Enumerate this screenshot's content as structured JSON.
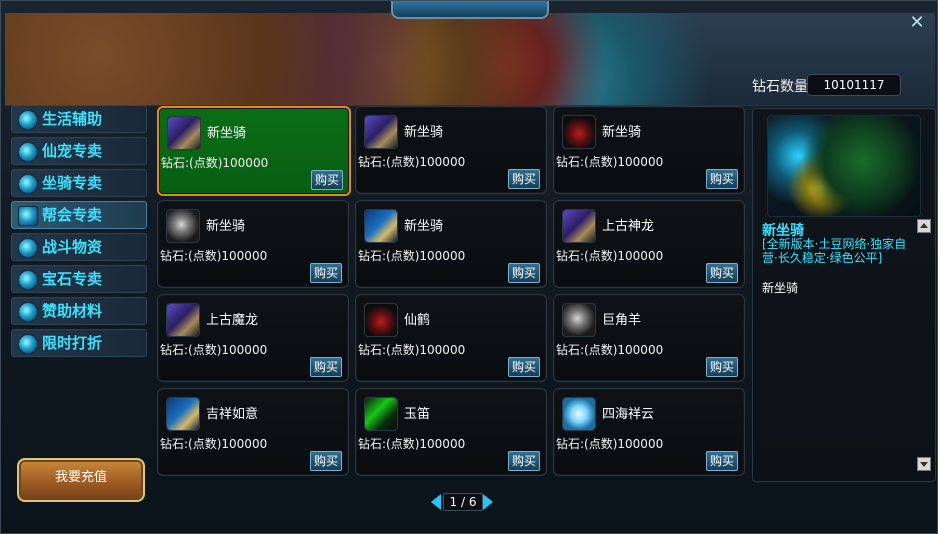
{
  "header": {
    "diamond_label": "钻石数量",
    "diamond_value": "10101117",
    "close_icon": "close-icon"
  },
  "menu": [
    {
      "label": "生活辅助",
      "icon": "life-icon"
    },
    {
      "label": "仙宠专卖",
      "icon": "paw-icon"
    },
    {
      "label": "坐骑专卖",
      "icon": "mount-icon"
    },
    {
      "label": "帮会专卖",
      "icon": "guild-icon"
    },
    {
      "label": "战斗物资",
      "icon": "battle-icon"
    },
    {
      "label": "宝石专卖",
      "icon": "gem-icon"
    },
    {
      "label": "赞助材料",
      "icon": "sponsor-icon"
    },
    {
      "label": "限时打折",
      "icon": "megaphone-icon"
    }
  ],
  "active_menu_index": 3,
  "recharge_label": "我要充值",
  "items": [
    {
      "name": "新坐骑",
      "price": "钻石:(点数)100000",
      "icon": "dragon-icon"
    },
    {
      "name": "新坐骑",
      "price": "钻石:(点数)100000",
      "icon": "dragon-icon"
    },
    {
      "name": "新坐骑",
      "price": "钻石:(点数)100000",
      "icon": "red-creature-icon"
    },
    {
      "name": "新坐骑",
      "price": "钻石:(点数)100000",
      "icon": "snake-icon"
    },
    {
      "name": "新坐骑",
      "price": "钻石:(点数)100000",
      "icon": "blue-mount-icon"
    },
    {
      "name": "上古神龙",
      "price": "钻石:(点数)100000",
      "icon": "dragon-icon"
    },
    {
      "name": "上古魔龙",
      "price": "钻石:(点数)100000",
      "icon": "dragon-icon"
    },
    {
      "name": "仙鹤",
      "price": "钻石:(点数)100000",
      "icon": "crane-icon"
    },
    {
      "name": "巨角羊",
      "price": "钻石:(点数)100000",
      "icon": "ram-icon"
    },
    {
      "name": "吉祥如意",
      "price": "钻石:(点数)100000",
      "icon": "ruyi-icon"
    },
    {
      "name": "玉笛",
      "price": "钻石:(点数)100000",
      "icon": "flute-icon"
    },
    {
      "name": "四海祥云",
      "price": "钻石:(点数)100000",
      "icon": "cloud-icon"
    }
  ],
  "buy_label": "购买",
  "selected_index": 0,
  "info": {
    "title": "新坐骑",
    "desc": "[全新版本·土豆网络·独家自营·长久稳定·绿色公平]",
    "name": "新坐骑"
  },
  "pager": {
    "text": "1 / 6"
  }
}
